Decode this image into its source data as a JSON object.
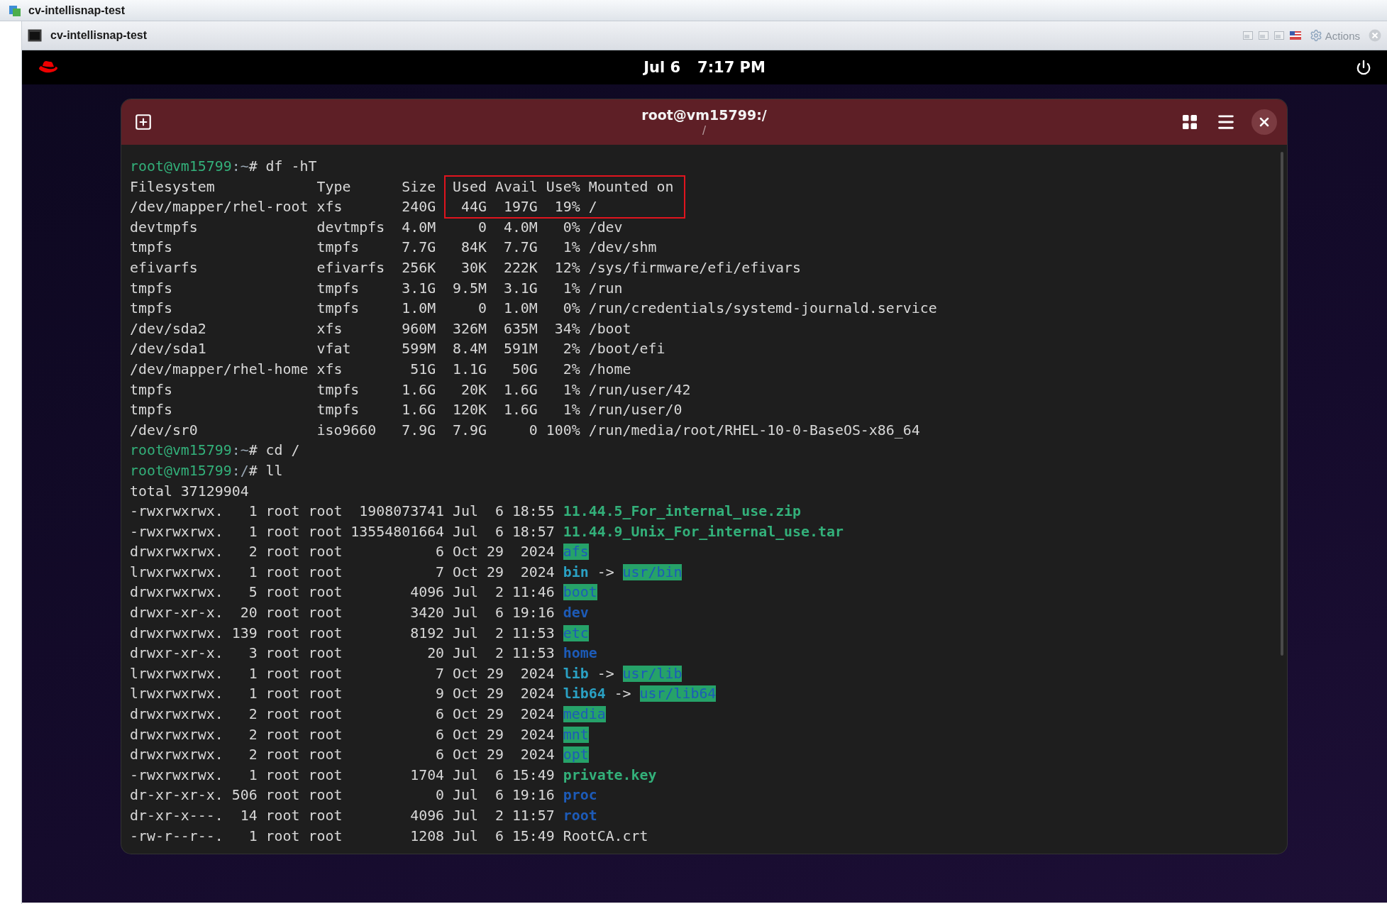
{
  "outer_window": {
    "title": "cv-intellisnap-test"
  },
  "console_window": {
    "title": "cv-intellisnap-test",
    "actions_label": "Actions"
  },
  "top_bar": {
    "date": "Jul 6",
    "time": "7:17 PM"
  },
  "terminal": {
    "title": "root@vm15799:/",
    "subtitle": "/",
    "highlight": {
      "kind": "box"
    },
    "lines": [
      {
        "kind": "prompt",
        "user_host": "root@vm15799",
        "path": ":~",
        "command": "# df -hT"
      },
      {
        "kind": "output",
        "text": "Filesystem            Type      Size  Used Avail Use% Mounted on"
      },
      {
        "kind": "output",
        "text": "/dev/mapper/rhel-root xfs       240G   44G  197G  19% /"
      },
      {
        "kind": "output",
        "text": "devtmpfs              devtmpfs  4.0M     0  4.0M   0% /dev"
      },
      {
        "kind": "output",
        "text": "tmpfs                 tmpfs     7.7G   84K  7.7G   1% /dev/shm"
      },
      {
        "kind": "output",
        "text": "efivarfs              efivarfs  256K   30K  222K  12% /sys/firmware/efi/efivars"
      },
      {
        "kind": "output",
        "text": "tmpfs                 tmpfs     3.1G  9.5M  3.1G   1% /run"
      },
      {
        "kind": "output",
        "text": "tmpfs                 tmpfs     1.0M     0  1.0M   0% /run/credentials/systemd-journald.service"
      },
      {
        "kind": "output",
        "text": "/dev/sda2             xfs       960M  326M  635M  34% /boot"
      },
      {
        "kind": "output",
        "text": "/dev/sda1             vfat      599M  8.4M  591M   2% /boot/efi"
      },
      {
        "kind": "output",
        "text": "/dev/mapper/rhel-home xfs        51G  1.1G   50G   2% /home"
      },
      {
        "kind": "output",
        "text": "tmpfs                 tmpfs     1.6G   20K  1.6G   1% /run/user/42"
      },
      {
        "kind": "output",
        "text": "tmpfs                 tmpfs     1.6G  120K  1.6G   1% /run/user/0"
      },
      {
        "kind": "output",
        "text": "/dev/sr0              iso9660   7.9G  7.9G     0 100% /run/media/root/RHEL-10-0-BaseOS-x86_64"
      },
      {
        "kind": "prompt",
        "user_host": "root@vm15799",
        "path": ":~",
        "command": "# cd /"
      },
      {
        "kind": "prompt",
        "user_host": "root@vm15799",
        "path": ":/",
        "command": "# ll"
      },
      {
        "kind": "output",
        "text": "total 37129904"
      },
      {
        "kind": "exec",
        "meta": "-rwxrwxrwx.   1 root root  1908073741 Jul  6 18:55",
        "name": "11.44.5_For_internal_use.zip"
      },
      {
        "kind": "exec",
        "meta": "-rwxrwxrwx.   1 root root 13554801664 Jul  6 18:57",
        "name": "11.44.9_Unix_For_internal_use.tar"
      },
      {
        "kind": "opendir",
        "meta": "drwxrwxrwx.   2 root root           6 Oct 29  2024",
        "name": "afs"
      },
      {
        "kind": "link",
        "meta": "lrwxrwxrwx.   1 root root           7 Oct 29  2024",
        "name": "bin",
        "arrow": "->",
        "target": "usr/bin"
      },
      {
        "kind": "opendir",
        "meta": "drwxrwxrwx.   5 root root        4096 Jul  2 11:46",
        "name": "boot"
      },
      {
        "kind": "dir",
        "meta": "drwxr-xr-x.  20 root root        3420 Jul  6 19:16",
        "name": "dev"
      },
      {
        "kind": "opendir",
        "meta": "drwxrwxrwx. 139 root root        8192 Jul  2 11:53",
        "name": "etc"
      },
      {
        "kind": "dir",
        "meta": "drwxr-xr-x.   3 root root          20 Jul  2 11:53",
        "name": "home"
      },
      {
        "kind": "link",
        "meta": "lrwxrwxrwx.   1 root root           7 Oct 29  2024",
        "name": "lib",
        "arrow": "->",
        "target": "usr/lib"
      },
      {
        "kind": "link",
        "meta": "lrwxrwxrwx.   1 root root           9 Oct 29  2024",
        "name": "lib64",
        "arrow": "->",
        "target": "usr/lib64"
      },
      {
        "kind": "opendir",
        "meta": "drwxrwxrwx.   2 root root           6 Oct 29  2024",
        "name": "media"
      },
      {
        "kind": "opendir",
        "meta": "drwxrwxrwx.   2 root root           6 Oct 29  2024",
        "name": "mnt"
      },
      {
        "kind": "opendir",
        "meta": "drwxrwxrwx.   2 root root           6 Oct 29  2024",
        "name": "opt"
      },
      {
        "kind": "exec",
        "meta": "-rwxrwxrwx.   1 root root        1704 Jul  6 15:49",
        "name": "private.key"
      },
      {
        "kind": "dir",
        "meta": "dr-xr-xr-x. 506 root root           0 Jul  6 19:16",
        "name": "proc"
      },
      {
        "kind": "dir",
        "meta": "dr-xr-x---.  14 root root        4096 Jul  2 11:57",
        "name": "root"
      },
      {
        "kind": "file",
        "meta": "-rw-r--r--.   1 root root        1208 Jul  6 15:49",
        "name": "RootCA.crt"
      }
    ]
  }
}
